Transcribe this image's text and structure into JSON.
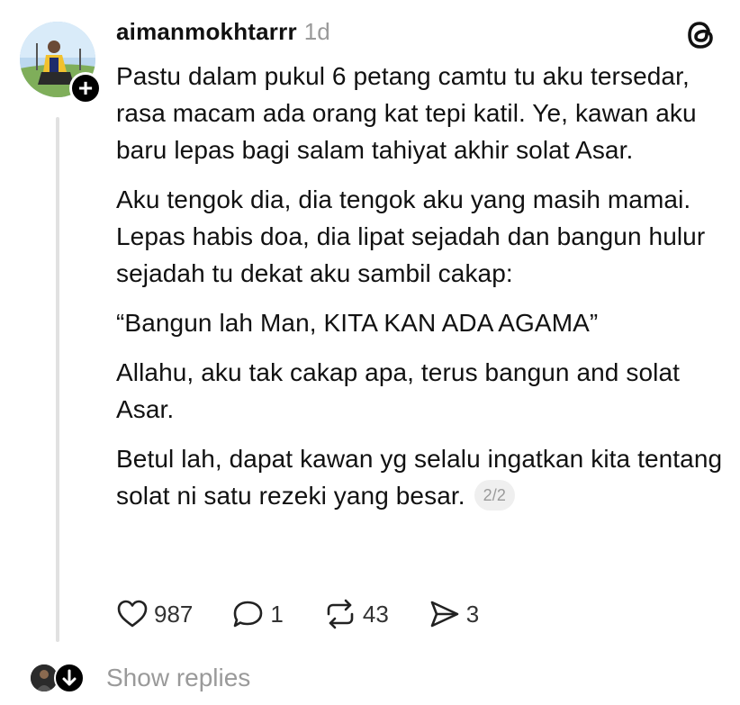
{
  "post": {
    "username": "aimanmokhtarrr",
    "time": "1d",
    "follow_symbol": "+",
    "paragraphs": [
      "Pastu dalam pukul 6 petang camtu tu aku tersedar, rasa macam ada orang kat tepi katil. Ye, kawan aku baru lepas bagi salam tahiyat akhir solat Asar.",
      "Aku tengok dia, dia tengok aku yang masih mamai. Lepas habis doa, dia lipat sejadah dan bangun hulur sejadah tu dekat aku sambil cakap:",
      "“Bangun lah Man, KITA KAN ADA AGAMA”",
      "Allahu, aku tak cakap apa, terus bangun and solat Asar.",
      "Betul lah, dapat kawan yg selalu ingatkan kita tentang solat ni satu rezeki yang besar."
    ],
    "page_indicator": "2/2"
  },
  "actions": {
    "likes": "987",
    "comments": "1",
    "reposts": "43",
    "shares": "3"
  },
  "icons": {
    "like": "heart-icon",
    "comment": "comment-bubble-icon",
    "repost": "repost-icon",
    "share": "send-icon",
    "logo": "threads-logo-icon",
    "replies": "arrow-down-icon"
  },
  "replies": {
    "label": "Show replies"
  },
  "colors": {
    "text": "#111111",
    "muted": "#9a9a9a",
    "thread_line": "#e1e1e1",
    "badge_bg": "#efefef"
  }
}
